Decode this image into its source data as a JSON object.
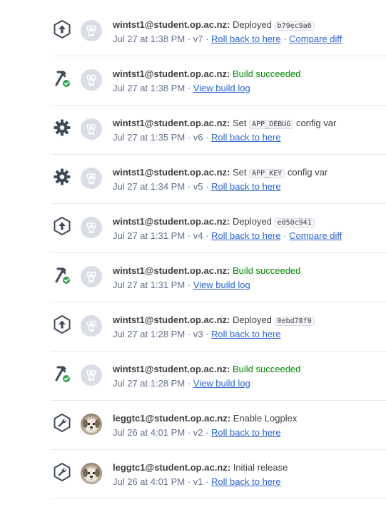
{
  "activity": [
    {
      "type": "deploy",
      "icon": "deploy-icon",
      "avatar": "default-avatar",
      "user": "wintst1@student.op.ac.nz:",
      "action": "Deployed",
      "code": "b79ec9a6",
      "action_suffix": "",
      "time": "Jul 27 at 1:38 PM",
      "version": "v7",
      "links": [
        "Roll back to here",
        "Compare diff"
      ]
    },
    {
      "type": "build",
      "icon": "build-succeeded-icon",
      "avatar": "default-avatar",
      "user": "wintst1@student.op.ac.nz:",
      "action": "Build succeeded",
      "time": "Jul 27 at 1:38 PM",
      "version": "",
      "links": [
        "View build log"
      ]
    },
    {
      "type": "config",
      "icon": "gear-icon",
      "avatar": "default-avatar",
      "user": "wintst1@student.op.ac.nz:",
      "action": "Set",
      "code": "APP_DEBUG",
      "action_suffix": "config var",
      "time": "Jul 27 at 1:35 PM",
      "version": "v6",
      "links": [
        "Roll back to here"
      ]
    },
    {
      "type": "config",
      "icon": "gear-icon",
      "avatar": "default-avatar",
      "user": "wintst1@student.op.ac.nz:",
      "action": "Set",
      "code": "APP_KEY",
      "action_suffix": "config var",
      "time": "Jul 27 at 1:34 PM",
      "version": "v5",
      "links": [
        "Roll back to here"
      ]
    },
    {
      "type": "deploy",
      "icon": "deploy-icon",
      "avatar": "default-avatar",
      "user": "wintst1@student.op.ac.nz:",
      "action": "Deployed",
      "code": "e050c941",
      "action_suffix": "",
      "time": "Jul 27 at 1:31 PM",
      "version": "v4",
      "links": [
        "Roll back to here",
        "Compare diff"
      ]
    },
    {
      "type": "build",
      "icon": "build-succeeded-icon",
      "avatar": "default-avatar",
      "user": "wintst1@student.op.ac.nz:",
      "action": "Build succeeded",
      "time": "Jul 27 at 1:31 PM",
      "version": "",
      "links": [
        "View build log"
      ]
    },
    {
      "type": "deploy",
      "icon": "deploy-icon",
      "avatar": "default-avatar",
      "user": "wintst1@student.op.ac.nz:",
      "action": "Deployed",
      "code": "0ebd78f9",
      "action_suffix": "",
      "time": "Jul 27 at 1:28 PM",
      "version": "v3",
      "links": [
        "Roll back to here"
      ]
    },
    {
      "type": "build",
      "icon": "build-succeeded-icon",
      "avatar": "default-avatar",
      "user": "wintst1@student.op.ac.nz:",
      "action": "Build succeeded",
      "time": "Jul 27 at 1:28 PM",
      "version": "",
      "links": [
        "View build log"
      ]
    },
    {
      "type": "addon",
      "icon": "wrench-icon",
      "avatar": "dog-avatar",
      "user": "leggtc1@student.op.ac.nz:",
      "action": "Enable Logplex",
      "time": "Jul 26 at 4:01 PM",
      "version": "v2",
      "links": [
        "Roll back to here"
      ]
    },
    {
      "type": "addon",
      "icon": "wrench-icon",
      "avatar": "dog-avatar",
      "user": "leggtc1@student.op.ac.nz:",
      "action": "Initial release",
      "time": "Jul 26 at 4:01 PM",
      "version": "v1",
      "links": [
        "Roll back to here"
      ]
    }
  ],
  "colors": {
    "success": "#008a00",
    "link": "#2a64d8",
    "muted": "#62708b",
    "icon": "#3f4a5c"
  }
}
